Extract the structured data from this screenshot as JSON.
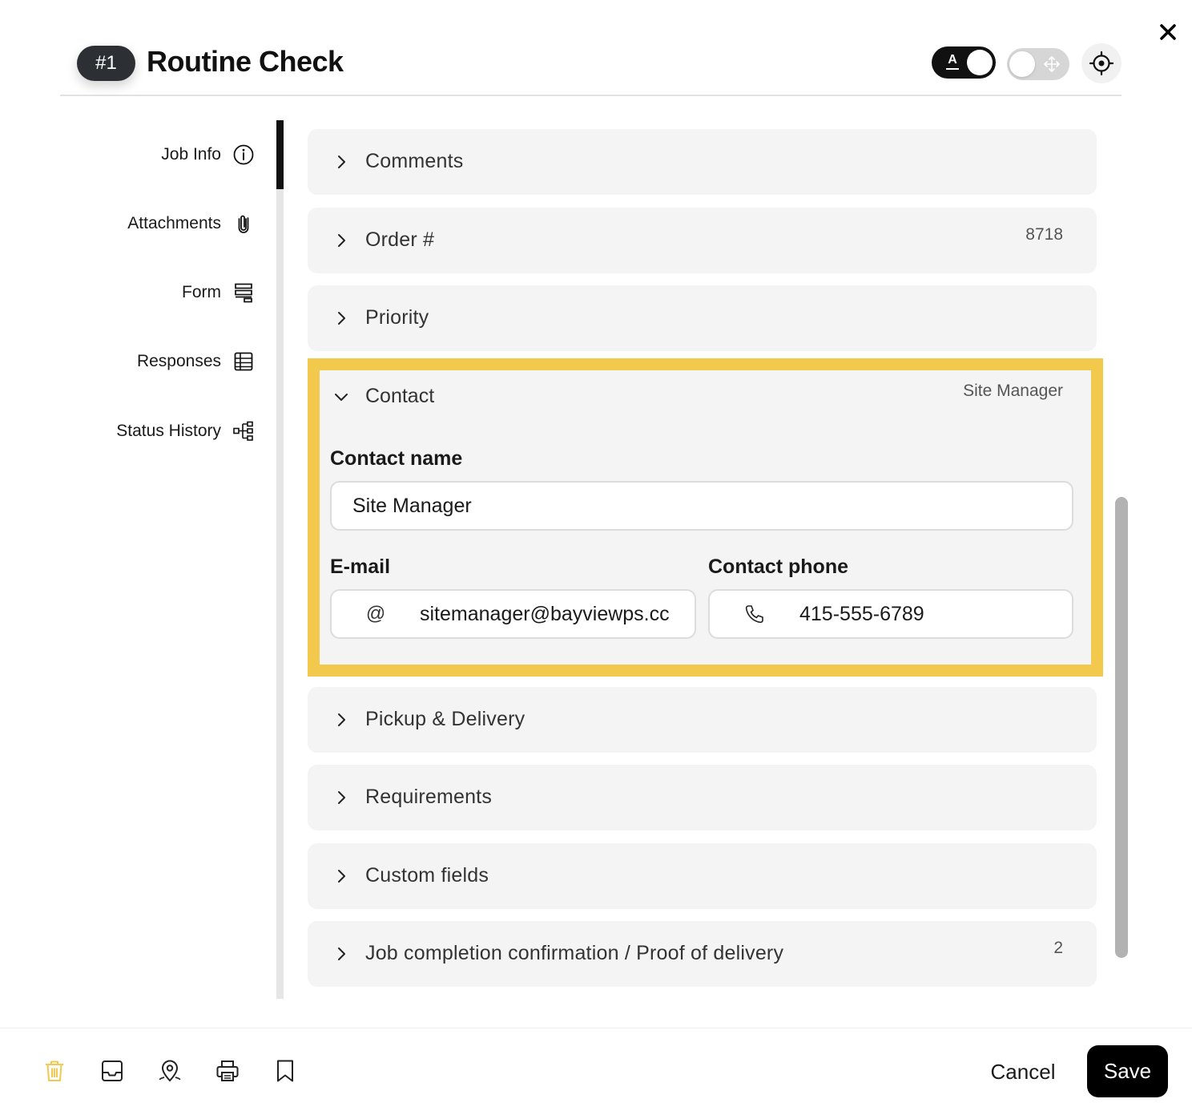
{
  "header": {
    "job_number": "#1",
    "title": "Routine Check",
    "text_toggle_glyph": "A"
  },
  "sidenav": {
    "items": [
      {
        "label": "Job Info",
        "icon": "info-icon"
      },
      {
        "label": "Attachments",
        "icon": "paperclip-icon"
      },
      {
        "label": "Form",
        "icon": "form-icon"
      },
      {
        "label": "Responses",
        "icon": "table-icon"
      },
      {
        "label": "Status History",
        "icon": "tree-icon"
      }
    ]
  },
  "sections": {
    "comments": {
      "label": "Comments",
      "value": ""
    },
    "order": {
      "label": "Order #",
      "value": "8718"
    },
    "priority": {
      "label": "Priority",
      "value": ""
    },
    "contact": {
      "label": "Contact",
      "value": "Site Manager",
      "contact_name_label": "Contact name",
      "contact_name_value": "Site Manager",
      "email_label": "E-mail",
      "email_prefix": "@",
      "email_value": "sitemanager@bayviewps.cc",
      "phone_label": "Contact phone",
      "phone_value": "415-555-6789"
    },
    "pickup": {
      "label": "Pickup & Delivery",
      "value": ""
    },
    "requirements": {
      "label": "Requirements",
      "value": ""
    },
    "custom": {
      "label": "Custom fields",
      "value": ""
    },
    "proof": {
      "label": "Job completion confirmation / Proof of delivery",
      "value": "2"
    }
  },
  "footer": {
    "cancel_label": "Cancel",
    "save_label": "Save"
  },
  "colors": {
    "highlight": "#f2c94c",
    "delete_icon": "#f2c94c",
    "primary": "#000000",
    "section_bg": "#f4f4f4"
  }
}
